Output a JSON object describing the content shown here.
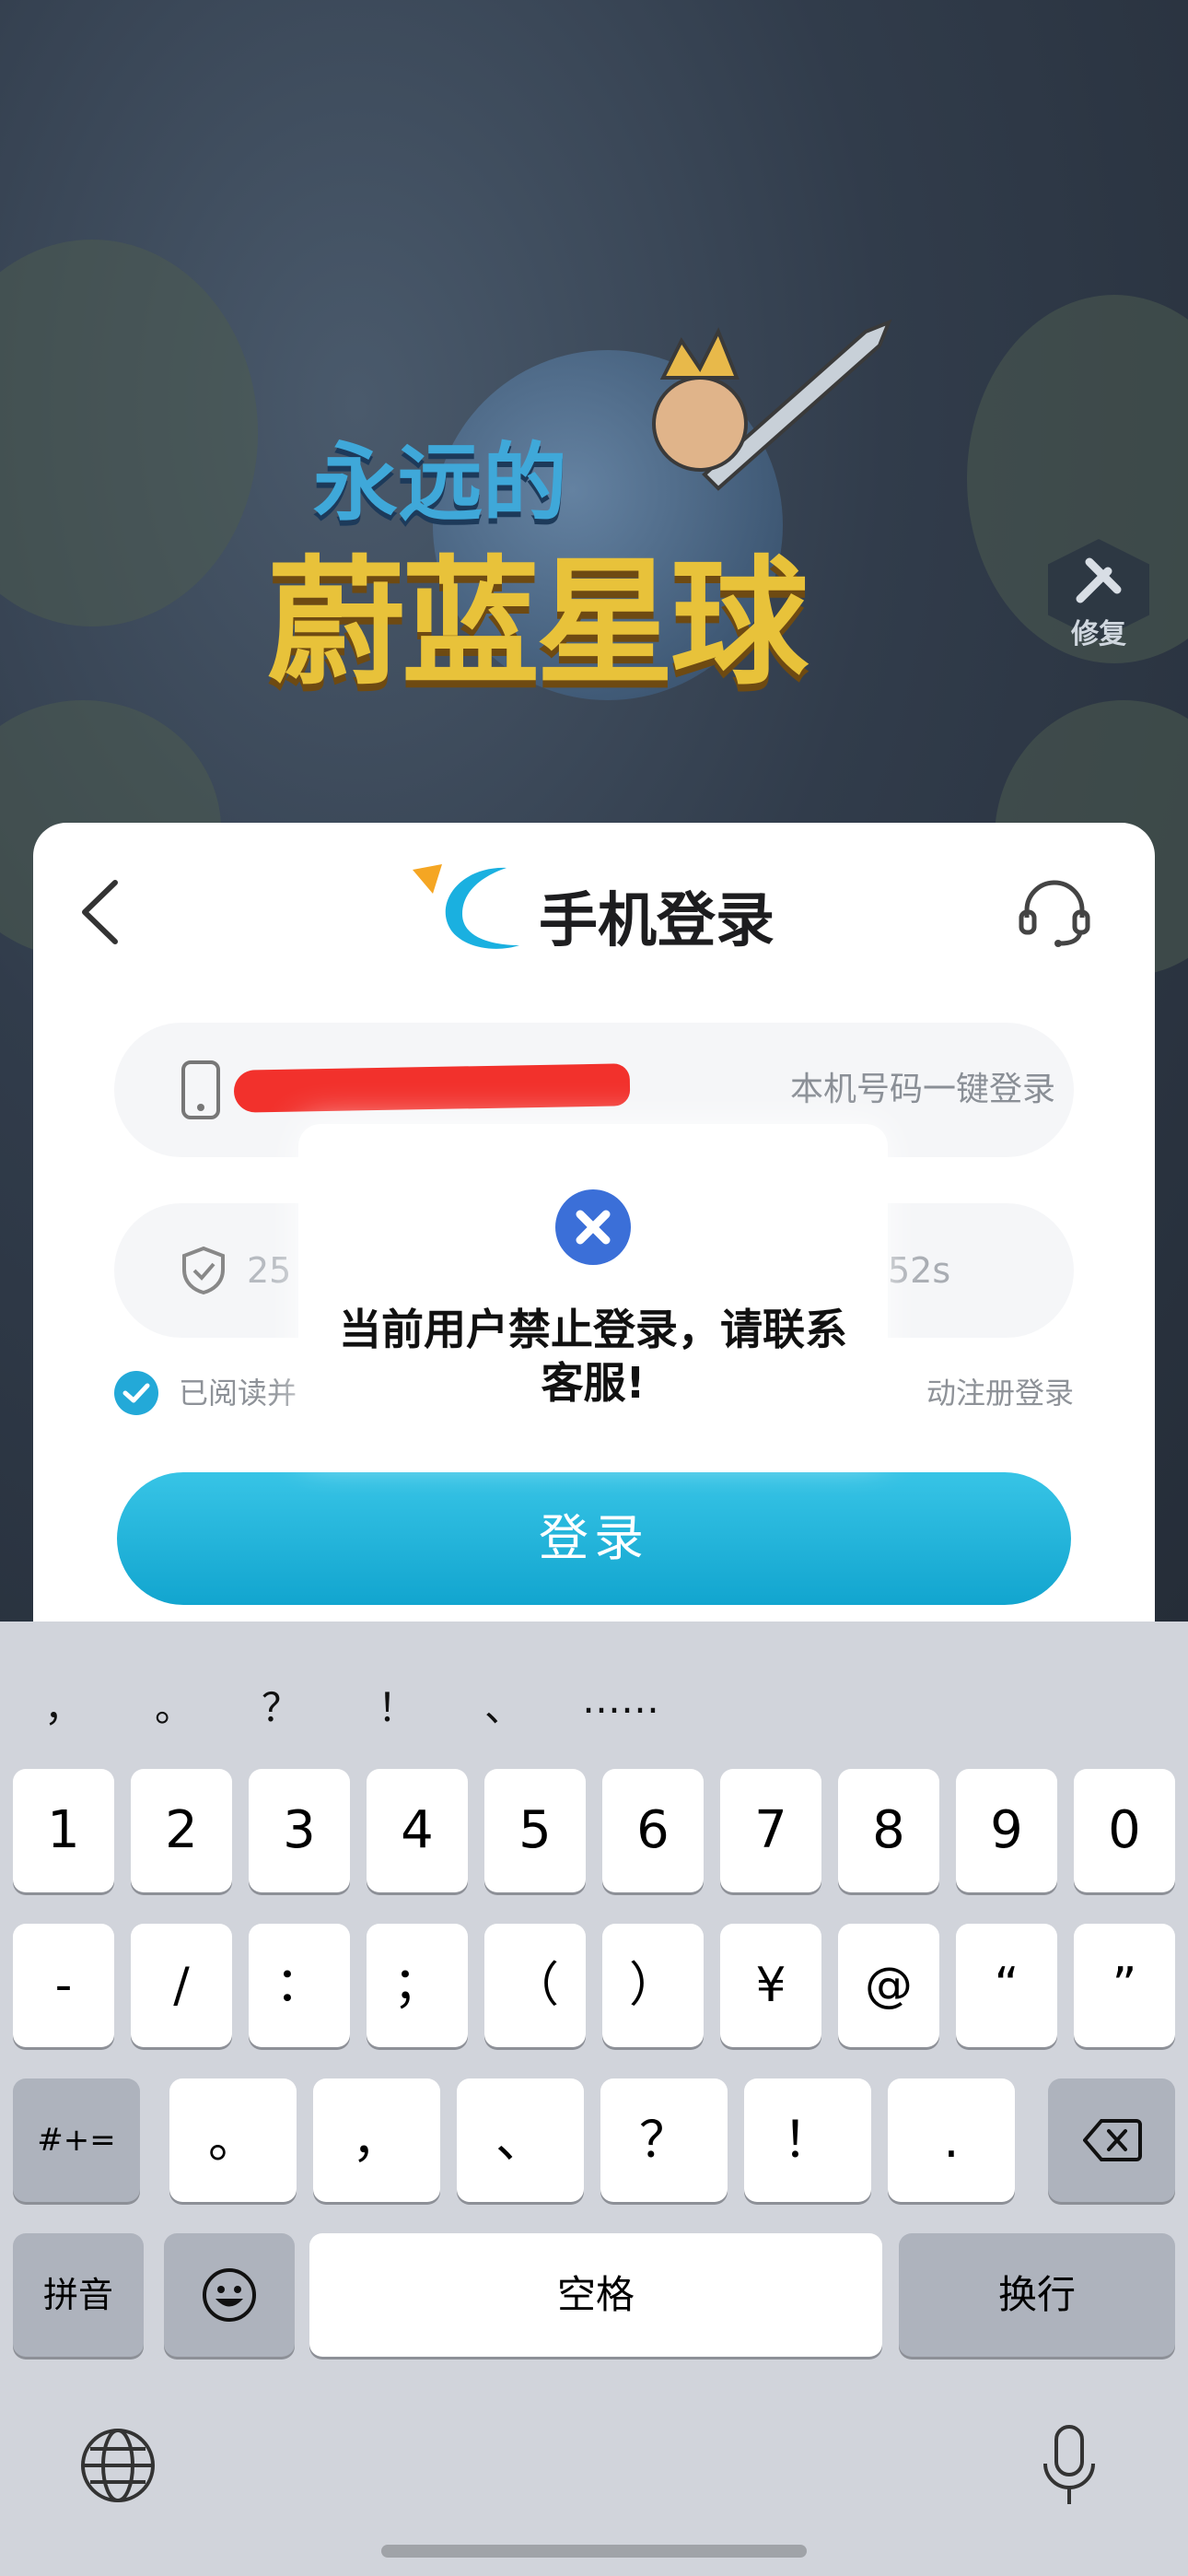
{
  "game": {
    "logo_line1": "永远的",
    "logo_line2": "蔚蓝星球",
    "repair_label": "修复"
  },
  "login_card": {
    "title": "手机登录",
    "phone_action": "本机号码一键登录",
    "code_value_partial": "25",
    "countdown_partial": "52s",
    "agreement_left": "已阅读并",
    "agreement_right": "动注册登录",
    "login_button": "登录",
    "accent_color": "#12a5cf"
  },
  "toast": {
    "message": "当前用户禁止登录，请联系客服!",
    "icon": "close-circle-icon",
    "icon_color": "#3b6fd8"
  },
  "keyboard": {
    "suggestions": [
      "，",
      "。",
      "？",
      "！",
      "、",
      "……"
    ],
    "row1": [
      "1",
      "2",
      "3",
      "4",
      "5",
      "6",
      "7",
      "8",
      "9",
      "0"
    ],
    "row2": [
      "-",
      "/",
      "：",
      "；",
      "（",
      "）",
      "¥",
      "@",
      "“",
      "”"
    ],
    "row3_mode": "#+=",
    "row3": [
      "。",
      "，",
      "、",
      "？",
      "！",
      "."
    ],
    "row4_pinyin": "拼音",
    "row4_space": "空格",
    "row4_return": "换行"
  }
}
